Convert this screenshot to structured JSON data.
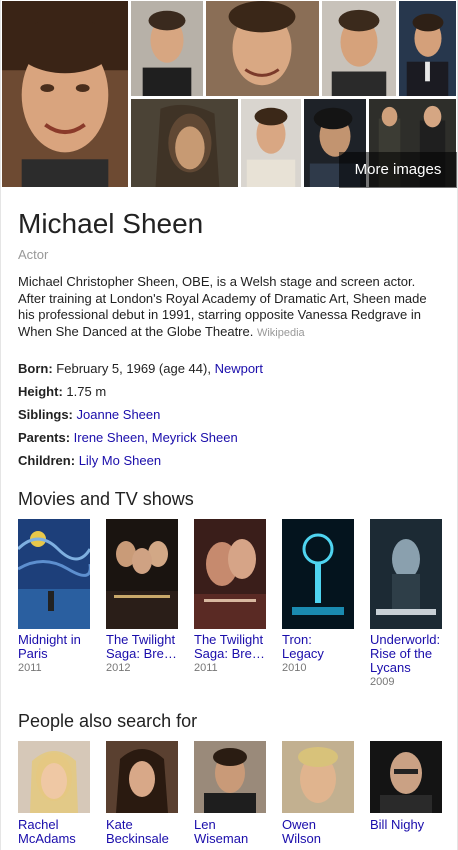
{
  "images": {
    "more_label": "More images"
  },
  "entity": {
    "name": "Michael Sheen",
    "type": "Actor",
    "description": "Michael Christopher Sheen, OBE, is a Welsh stage and screen actor. After training at London's Royal Academy of Dramatic Art, Sheen made his professional debut in 1991, starring opposite Vanessa Redgrave in When She Danced at the Globe Theatre.",
    "source": "Wikipedia"
  },
  "facts": {
    "born_label": "Born:",
    "born_value": "February 5, 1969 (age 44),",
    "born_place": "Newport",
    "height_label": "Height:",
    "height_value": "1.75 m",
    "siblings_label": "Siblings:",
    "siblings_value": "Joanne Sheen",
    "parents_label": "Parents:",
    "parent_1": "Irene Sheen,",
    "parent_2": "Meyrick Sheen",
    "children_label": "Children:",
    "children_value": "Lily Mo Sheen"
  },
  "movies": {
    "title": "Movies and TV shows",
    "items": [
      {
        "name": "Midnight in Paris",
        "year": "2011"
      },
      {
        "name": "The Twilight Saga: Bre…",
        "year": "2012"
      },
      {
        "name": "The Twilight Saga: Bre…",
        "year": "2011"
      },
      {
        "name": "Tron: Legacy",
        "year": "2010"
      },
      {
        "name": "Underworld: Rise of the Lycans",
        "year": "2009"
      }
    ]
  },
  "people": {
    "title": "People also search for",
    "items": [
      {
        "name": "Rachel McAdams"
      },
      {
        "name": "Kate Beckinsale"
      },
      {
        "name": "Len Wiseman"
      },
      {
        "name": "Owen Wilson"
      },
      {
        "name": "Bill Nighy"
      }
    ]
  },
  "colors": {
    "link": "#1a0dab",
    "muted": "#999999",
    "text": "#222222"
  }
}
